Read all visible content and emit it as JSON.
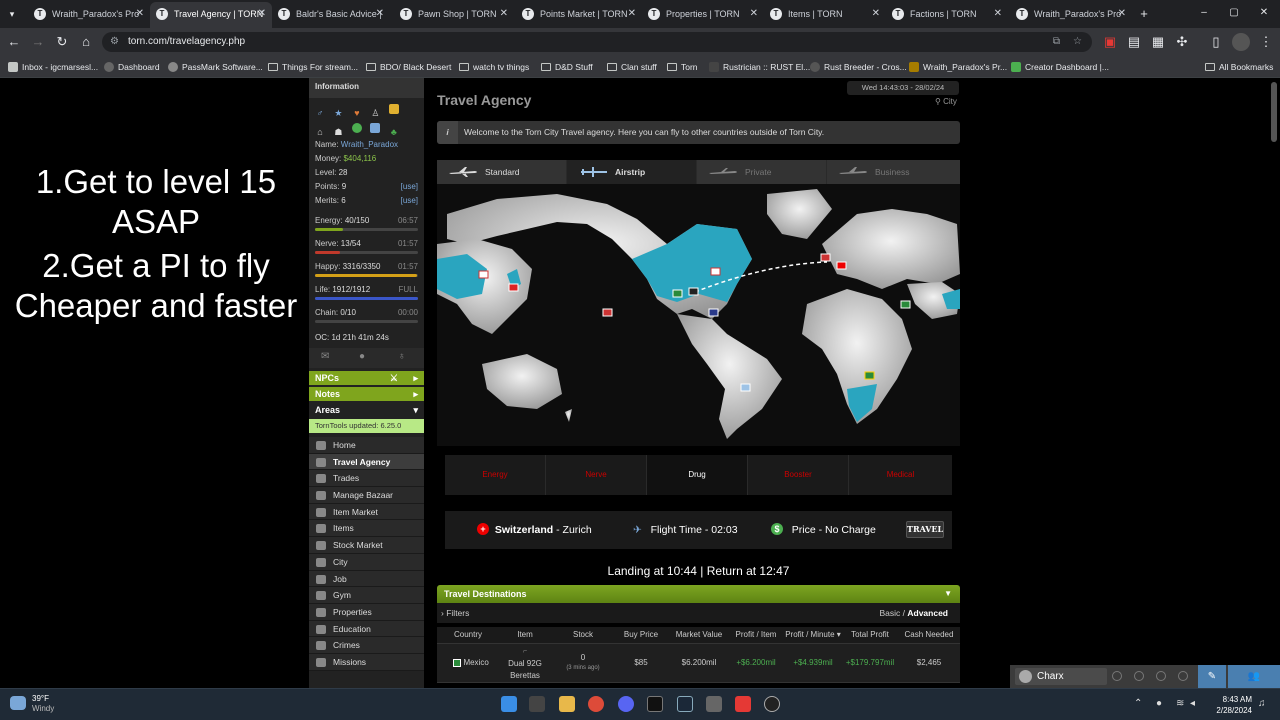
{
  "browser": {
    "tabs": [
      {
        "label": "Wraith_Paradox's Pro",
        "active": false
      },
      {
        "label": "Travel Agency | TORN",
        "active": true
      },
      {
        "label": "Baldr's Basic Advice |",
        "active": false
      },
      {
        "label": "Pawn Shop | TORN",
        "active": false
      },
      {
        "label": "Points Market | TORN",
        "active": false
      },
      {
        "label": "Properties | TORN",
        "active": false
      },
      {
        "label": "Items | TORN",
        "active": false
      },
      {
        "label": "Factions | TORN",
        "active": false
      },
      {
        "label": "Wraith_Paradox's Pro",
        "active": false
      }
    ],
    "url": "torn.com/travelagency.php",
    "bookmarks": [
      "Inbox - igcmarsesl...",
      "Dashboard",
      "PassMark Software...",
      "Things For stream...",
      "BDO/ Black Desert",
      "watch tv things",
      "D&D Stuff",
      "Clan stuff",
      "Torn",
      "Rustrician :: RUST El...",
      "Rust Breeder - Cros...",
      "Wraith_Paradox's Pr...",
      "Creator Dashboard |..."
    ],
    "all_bookmarks": "All Bookmarks"
  },
  "overlay": {
    "line1": "1.Get to level 15",
    "line2": "ASAP",
    "line3": "2.Get a PI to fly",
    "line4": "Cheaper and faster"
  },
  "sidebar": {
    "information": "Information",
    "name_label": "Name:",
    "name": "Wraith_Paradox",
    "money_label": "Money:",
    "money": "$404,116",
    "level_label": "Level:",
    "level": "28",
    "points_label": "Points:",
    "points": "9",
    "merits_label": "Merits:",
    "merits": "6",
    "use": "[use]",
    "energy_label": "Energy:",
    "energy": "40/150",
    "energy_time": "06:57",
    "energy_pct": 0.27,
    "nerve_label": "Nerve:",
    "nerve": "13/54",
    "nerve_time": "01:57",
    "nerve_pct": 0.24,
    "happy_label": "Happy:",
    "happy": "3316/3350",
    "happy_time": "01:57",
    "happy_pct": 0.99,
    "life_label": "Life:",
    "life": "1912/1912",
    "life_time": "FULL",
    "life_pct": 1.0,
    "chain_label": "Chain:",
    "chain": "0/10",
    "chain_time": "00:00",
    "oc": "OC: 1d 21h 41m 24s",
    "npcs": "NPCs",
    "notes": "Notes",
    "areas": "Areas",
    "torntools": "TornTools updated: 6.25.0",
    "nav": [
      "Home",
      "Travel Agency",
      "Trades",
      "Manage Bazaar",
      "Item Market",
      "Items",
      "Stock Market",
      "City",
      "Job",
      "Gym",
      "Properties",
      "Education",
      "Crimes",
      "Missions"
    ],
    "colors": {
      "energy": "#7fa51d",
      "nerve": "#c0392b",
      "happy": "#d4a017",
      "life": "#3a56c8"
    }
  },
  "main": {
    "title": "Travel Agency",
    "datetime": "Wed 14:43:03 - 28/02/24",
    "city": "City",
    "info": "Welcome to the Torn City Travel agency. Here you can fly to other countries outside of Torn City.",
    "info_icon": "i",
    "travel_tabs": [
      "Standard",
      "Airstrip",
      "Private",
      "Business"
    ],
    "categories": [
      "Energy",
      "Nerve",
      "Drug",
      "Booster",
      "Medical"
    ],
    "destination_country": "Switzerland",
    "destination_city": " - Zurich",
    "flight_time": "Flight Time - 02:03",
    "price": "Price - No Charge",
    "price_icon": "$",
    "travel_button": "TRAVEL",
    "landing": "Landing at 10:44 | Return at 12:47",
    "destinations_title": "Travel Destinations",
    "filters": "Filters",
    "basic": "Basic / ",
    "advanced": "Advanced",
    "columns": [
      "Country",
      "Item",
      "Stock",
      "Buy Price",
      "Market Value",
      "Profit / Item",
      "Profit / Minute ▾",
      "Total Profit",
      "Cash Needed"
    ],
    "row": {
      "country": "Mexico",
      "item1": "Dual 92G",
      "item2": "Berettas",
      "stock": "0",
      "stock_age": "(3 mins ago)",
      "buy_price": "$85",
      "market_value": "$6.200mil",
      "profit_item": "+$6.200mil",
      "profit_minute": "+$4.939mil",
      "total_profit": "+$179.797mil",
      "cash_needed": "$2,465"
    }
  },
  "chat": {
    "name": "Charx"
  },
  "taskbar": {
    "temp": "39°F",
    "weather": "Windy",
    "time": "8:43 AM",
    "date": "2/28/2024"
  }
}
